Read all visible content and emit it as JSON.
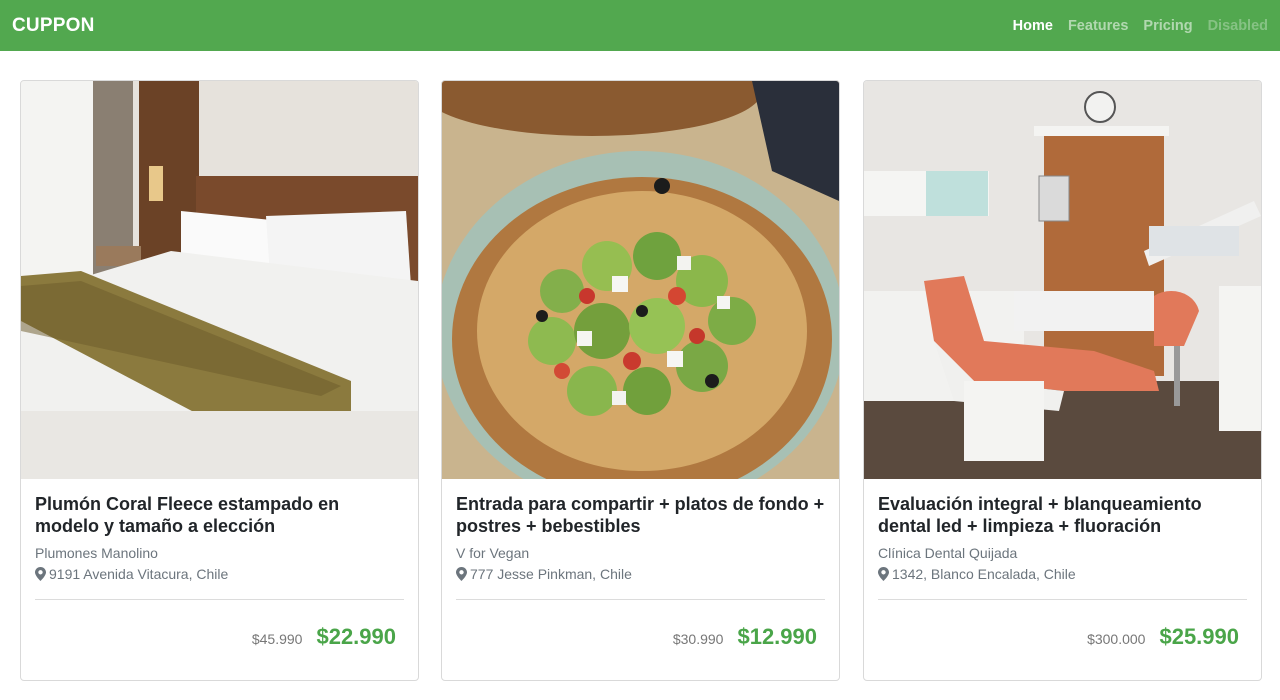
{
  "navbar": {
    "brand": "CUPPON",
    "links": [
      {
        "label": "Home"
      },
      {
        "label": "Features"
      },
      {
        "label": "Pricing"
      },
      {
        "label": "Disabled"
      }
    ]
  },
  "colors": {
    "navbar": "#52a84f",
    "price": "#4aa549"
  },
  "deals": [
    {
      "title": "Plumón Coral Fleece estampado en modelo y tamaño a elección",
      "merchant": "Plumones Manolino",
      "address": "9191 Avenida Vitacura, Chile",
      "old_price": "$45.990",
      "new_price": "$22.990",
      "image": "hotel-bed-photo"
    },
    {
      "title": "Entrada para compartir + platos de fondo + postres + bebestibles",
      "merchant": "V for Vegan",
      "address": "777 Jesse Pinkman, Chile",
      "old_price": "$30.990",
      "new_price": "$12.990",
      "image": "salad-bowl-photo"
    },
    {
      "title": "Evaluación integral + blanqueamiento dental led + limpieza + fluoración",
      "merchant": "Clínica Dental Quijada",
      "address": "1342, Blanco Encalada, Chile",
      "old_price": "$300.000",
      "new_price": "$25.990",
      "image": "dental-clinic-photo"
    }
  ]
}
